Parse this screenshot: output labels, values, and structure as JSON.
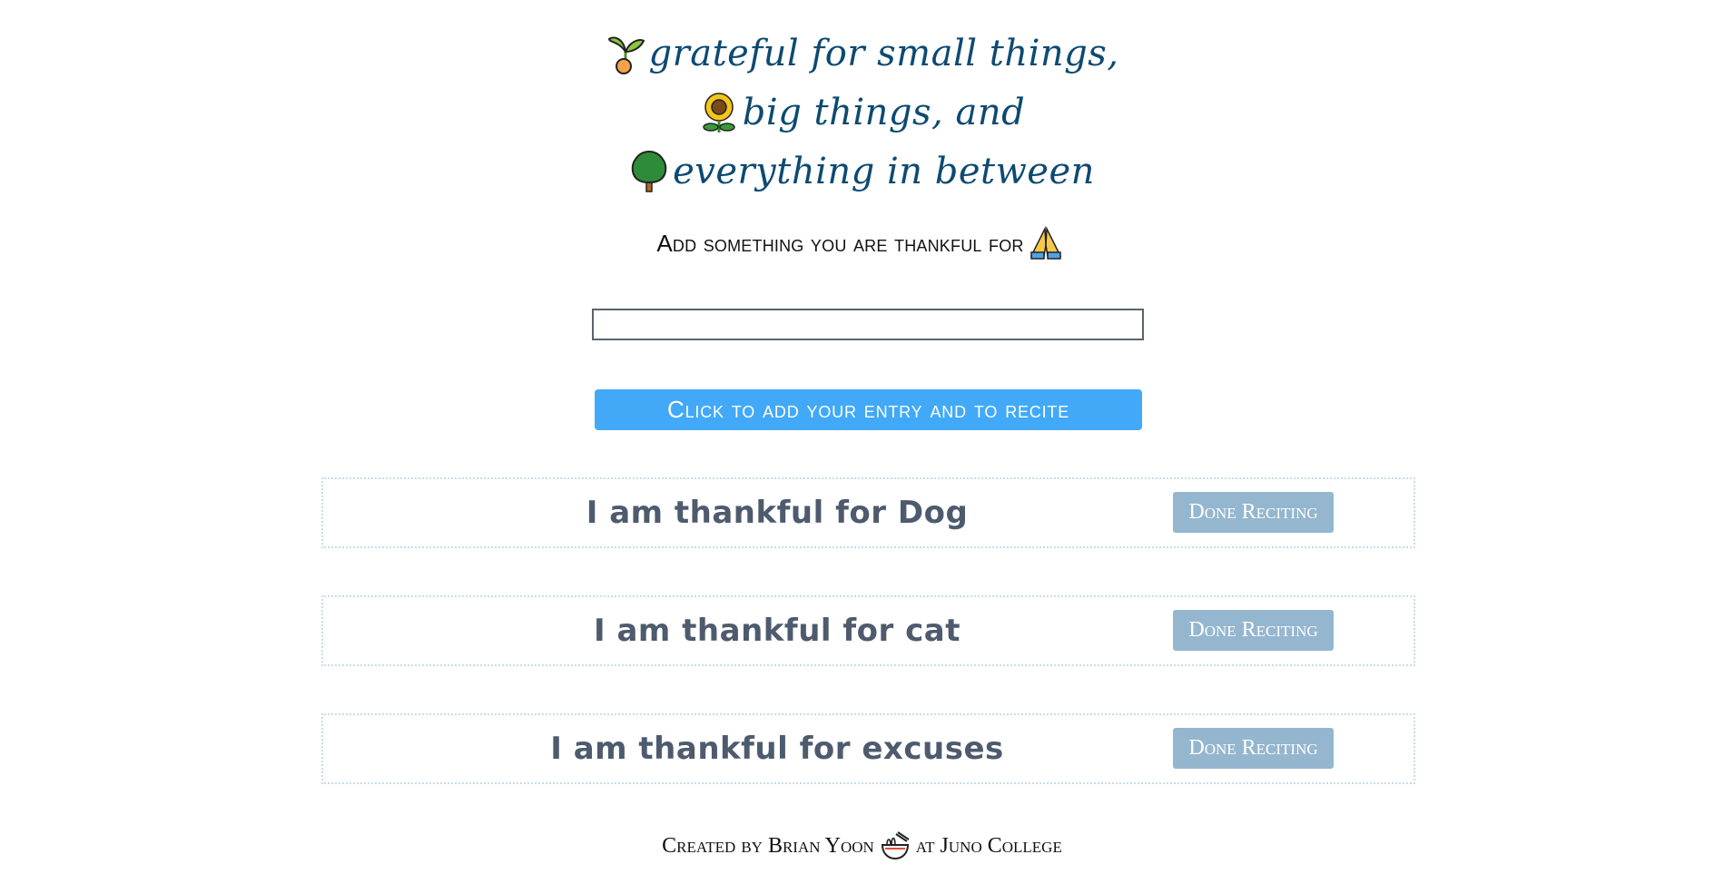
{
  "header": {
    "lines": [
      {
        "icon": "seedling-icon",
        "text": "grateful for small things,"
      },
      {
        "icon": "sunflower-icon",
        "text": "big things, and"
      },
      {
        "icon": "tree-icon",
        "text": "everything in between"
      }
    ]
  },
  "prompt": {
    "text": "Add something you are thankful for",
    "icon": "praying-hands-icon"
  },
  "entry": {
    "value": "",
    "placeholder": ""
  },
  "add_button": {
    "label": "Click to add your entry and to recite"
  },
  "entries": [
    {
      "text": "I am thankful for Dog",
      "button_label": "Done Reciting"
    },
    {
      "text": "I am thankful for cat",
      "button_label": "Done Reciting"
    },
    {
      "text": "I am thankful for excuses",
      "button_label": "Done Reciting"
    }
  ],
  "footer": {
    "prefix": "Created by Brian Yoon",
    "icon": "noodle-bowl-icon",
    "suffix": "at Juno College"
  },
  "colors": {
    "title": "#0d4a72",
    "button_primary": "#41a9f8",
    "button_done": "#95b6cf",
    "entry_text": "#4e5b6e",
    "entry_border": "#c8dde8"
  }
}
